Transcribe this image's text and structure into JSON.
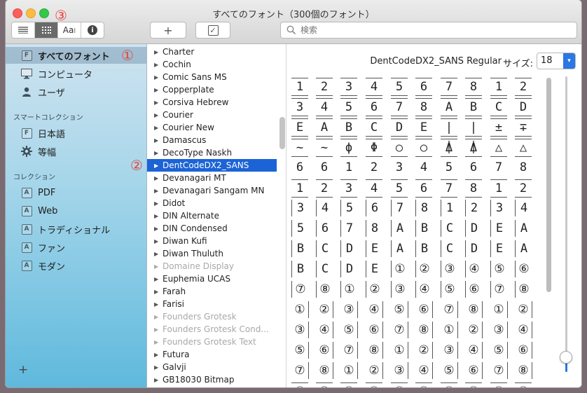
{
  "window": {
    "title": "すべてのフォント（300個のフォント）"
  },
  "annotations": {
    "a1": "①",
    "a2": "②",
    "a3": "③"
  },
  "toolbar": {
    "view_text": "Aa",
    "view_text_cursor": "I",
    "info_glyph": "i",
    "add_glyph": "+",
    "check_glyph": "✓",
    "search_placeholder": "検索"
  },
  "sidebar": {
    "library_items": [
      {
        "label": "すべてのフォント",
        "icon": "font-box-icon",
        "selected": true
      },
      {
        "label": "コンピュータ",
        "icon": "monitor-icon"
      },
      {
        "label": "ユーザ",
        "icon": "user-icon"
      }
    ],
    "smart_header": "スマートコレクション",
    "smart_items": [
      {
        "label": "日本語",
        "icon": "font-box-icon"
      },
      {
        "label": "等幅",
        "icon": "gear-icon"
      }
    ],
    "collections_header": "コレクション",
    "collection_items": [
      {
        "label": "PDF"
      },
      {
        "label": "Web"
      },
      {
        "label": "トラディショナル"
      },
      {
        "label": "ファン"
      },
      {
        "label": "モダン"
      }
    ],
    "add_glyph": "+",
    "font_box_glyph": "F",
    "collection_glyph": "A"
  },
  "font_list": [
    {
      "name": "Charter"
    },
    {
      "name": "Cochin"
    },
    {
      "name": "Comic Sans MS"
    },
    {
      "name": "Copperplate"
    },
    {
      "name": "Corsiva Hebrew"
    },
    {
      "name": "Courier"
    },
    {
      "name": "Courier New"
    },
    {
      "name": "Damascus"
    },
    {
      "name": "DecoType Naskh"
    },
    {
      "name": "DentCodeDX2_SANS",
      "selected": true
    },
    {
      "name": "Devanagari MT"
    },
    {
      "name": "Devanagari Sangam MN"
    },
    {
      "name": "Didot"
    },
    {
      "name": "DIN Alternate"
    },
    {
      "name": "DIN Condensed"
    },
    {
      "name": "Diwan Kufi"
    },
    {
      "name": "Diwan Thuluth"
    },
    {
      "name": "Domaine Display",
      "disabled": true
    },
    {
      "name": "Euphemia UCAS"
    },
    {
      "name": "Farah"
    },
    {
      "name": "Farisi"
    },
    {
      "name": "Founders Grotesk",
      "disabled": true
    },
    {
      "name": "Founders Grotesk Cond...",
      "disabled": true
    },
    {
      "name": "Founders Grotesk Text",
      "disabled": true
    },
    {
      "name": "Futura"
    },
    {
      "name": "Galvji"
    },
    {
      "name": "GB18030 Bitmap"
    }
  ],
  "preview": {
    "font_name": "DentCodeDX2_SANS Regular",
    "size_label": "サイズ:",
    "size_value": "18",
    "size_arrow": "▾",
    "glyph_rows": [
      [
        "1",
        "2",
        "3",
        "4",
        "5",
        "6",
        "7",
        "8",
        "1",
        "2"
      ],
      [
        "3",
        "4",
        "5",
        "6",
        "7",
        "8",
        "A",
        "B",
        "C",
        "D"
      ],
      [
        "E",
        "A",
        "B",
        "C",
        "D",
        "E",
        "|",
        "|",
        "±",
        "∓"
      ],
      [
        "~",
        "~",
        "ϕ",
        "Φ",
        "○",
        "○",
        "⍋",
        "⍋",
        "△",
        "△"
      ],
      [
        "6",
        "6",
        "1",
        "2",
        "3",
        "4",
        "5",
        "6",
        "7",
        "8"
      ],
      [
        "1",
        "2",
        "3",
        "4",
        "5",
        "6",
        "7",
        "8",
        "1",
        "2"
      ],
      [
        "3",
        "4",
        "5",
        "6",
        "7",
        "8",
        "1",
        "2",
        "3",
        "4"
      ],
      [
        "5",
        "6",
        "7",
        "8",
        "A",
        "B",
        "C",
        "D",
        "E",
        "A"
      ],
      [
        "B",
        "C",
        "D",
        "E",
        "A",
        "B",
        "C",
        "D",
        "E",
        "A"
      ],
      [
        "B",
        "C",
        "D",
        "E",
        "①",
        "②",
        "③",
        "④",
        "⑤",
        "⑥"
      ],
      [
        "⑦",
        "⑧",
        "①",
        "②",
        "③",
        "④",
        "⑤",
        "⑥",
        "⑦",
        "⑧"
      ],
      [
        "①",
        "②",
        "③",
        "④",
        "⑤",
        "⑥",
        "⑦",
        "⑧",
        "①",
        "②"
      ],
      [
        "③",
        "④",
        "⑤",
        "⑥",
        "⑦",
        "⑧",
        "①",
        "②",
        "③",
        "④"
      ],
      [
        "⑤",
        "⑥",
        "⑦",
        "⑧",
        "①",
        "②",
        "③",
        "④",
        "⑤",
        "⑥"
      ],
      [
        "⑦",
        "⑧",
        "①",
        "②",
        "③",
        "④",
        "⑤",
        "⑥",
        "⑦",
        "⑧"
      ],
      [
        "①",
        "②",
        "③",
        "④",
        "⑤",
        "⑥",
        "⑦",
        "⑧",
        "①",
        "②"
      ]
    ],
    "frame_styles": [
      "bx",
      "bx",
      "bx",
      "bx",
      "plain",
      "bx",
      "bl",
      "bl",
      "bl",
      "bl",
      "bl",
      "br",
      "br",
      "br",
      "br",
      "bx"
    ]
  },
  "colors": {
    "accent": "#1c63d6",
    "annotation": "#e8413a",
    "slider_fill": "#2b77e4"
  }
}
